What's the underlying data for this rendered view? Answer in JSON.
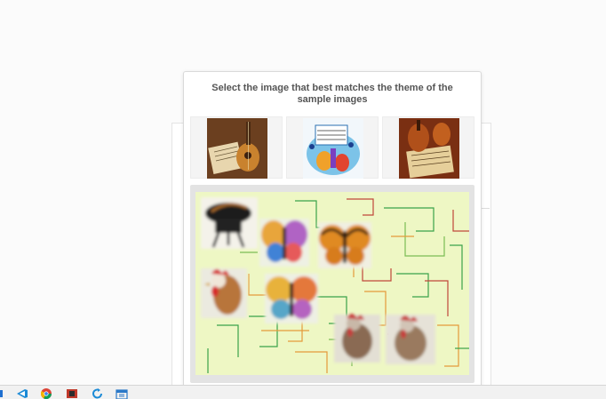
{
  "captcha": {
    "prompt": "Select the image that best matches the theme of the sample images",
    "samples": [
      {
        "icon": "guitar-sheet-music-icon"
      },
      {
        "icon": "colorful-instruments-music-notes-icon"
      },
      {
        "icon": "violin-sheet-music-icon"
      }
    ],
    "choices": [
      {
        "icon": "piano-chair-icon"
      },
      {
        "icon": "butterfly-icon"
      },
      {
        "icon": "butterfly-icon"
      },
      {
        "icon": "rooster-icon"
      },
      {
        "icon": "butterfly-icon"
      },
      {
        "icon": "rooster-icon"
      },
      {
        "icon": "rooster-icon"
      }
    ]
  },
  "taskbar": {
    "icons": [
      "start-icon",
      "vscode-icon",
      "chrome-icon",
      "app-icon",
      "refresh-app-icon",
      "calendar-icon"
    ]
  },
  "colors": {
    "puzzle_bg": "#eef7c4",
    "line_green": "#3aa34a",
    "line_red": "#c0473a",
    "line_orange": "#e59a3a"
  }
}
